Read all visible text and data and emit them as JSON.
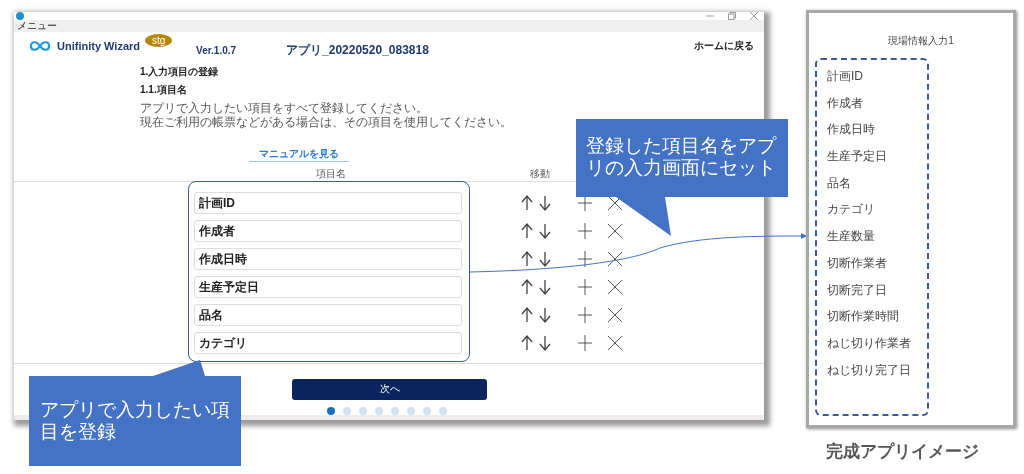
{
  "window": {
    "menu": "メニュー",
    "logo": "Unifinity Wizard",
    "badge": "stg",
    "version": "Ver.1.0.7",
    "app_name": "アプリ_20220520_083818",
    "home_link": "ホームに戻る"
  },
  "section": {
    "title": "1.入力項目の登録",
    "subtitle": "1.1.項目名",
    "description": [
      "アプリで入力したい項目をすべて登録してください。",
      "現在ご利用の帳票などがある場合は、その項目を使用してください。"
    ],
    "manual_link": "マニュアルを見る"
  },
  "table": {
    "columns": [
      "項目名",
      "移動"
    ],
    "rows": [
      {
        "name": "計画ID"
      },
      {
        "name": "作成者"
      },
      {
        "name": "作成日時"
      },
      {
        "name": "生産予定日"
      },
      {
        "name": "品名"
      },
      {
        "name": "カテゴリ"
      }
    ]
  },
  "next_button": "次へ",
  "pager": [
    {
      "selected": true
    },
    {
      "selected": false
    },
    {
      "selected": false
    },
    {
      "selected": false
    },
    {
      "selected": false
    },
    {
      "selected": false
    },
    {
      "selected": false
    },
    {
      "selected": false
    }
  ],
  "callouts": [
    {
      "text": "登録した項目名をアプリの入力画面にセット"
    },
    {
      "text": "アプリで入力したい項目を登録"
    }
  ],
  "preview": {
    "title": "現場情報入力1",
    "fields": [
      "計画ID",
      "作成者",
      "作成日時",
      "生産予定日",
      "品名",
      "カテゴリ",
      "生産数量",
      "切断作業者",
      "切断完了日",
      "切断作業時間",
      "ねじ切り作業者",
      "ねじ切り完了日"
    ]
  },
  "caption": "完成アプリイメージ"
}
